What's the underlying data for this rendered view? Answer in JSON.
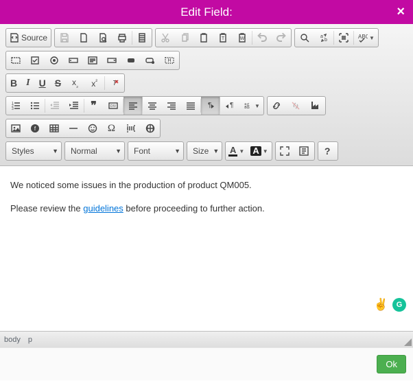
{
  "dialog": {
    "title": "Edit Field:",
    "close_label": "×"
  },
  "toolbar": {
    "source_label": "Source",
    "styles": {
      "label": "Styles"
    },
    "format": {
      "label": "Normal"
    },
    "font": {
      "label": "Font"
    },
    "size": {
      "label": "Size"
    },
    "help_label": "?"
  },
  "content": {
    "para1_a": "We noticed some issues in the production of product QM005.",
    "para2_a": "Please review the ",
    "link_text": "guidelines",
    "para2_b": " before proceeding to further action."
  },
  "path": {
    "body": "body",
    "p": "p"
  },
  "footer": {
    "ok": "Ok"
  },
  "badges": {
    "peace": "✌️",
    "g": "G"
  }
}
